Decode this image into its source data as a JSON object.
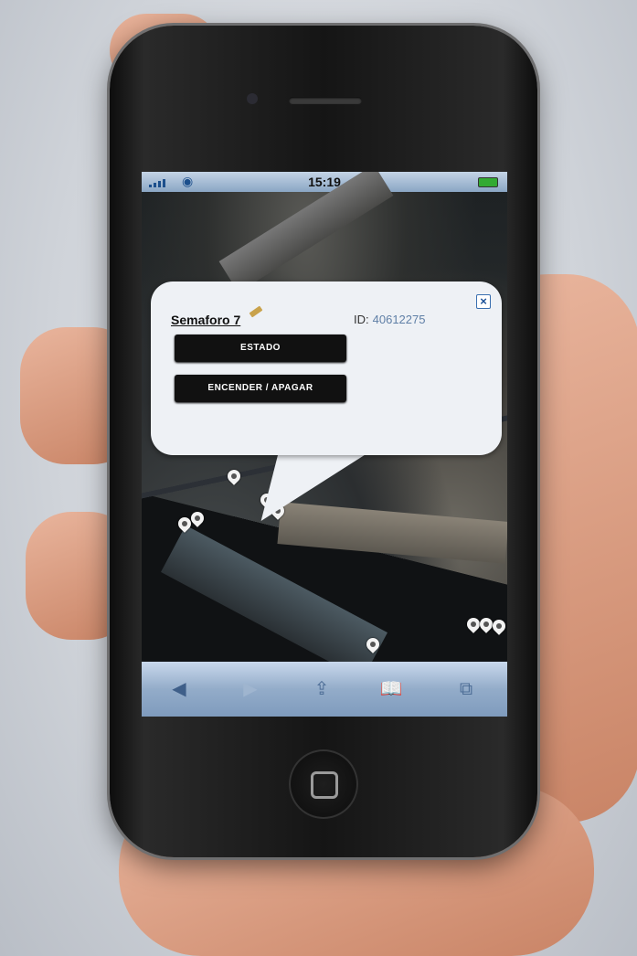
{
  "status_bar": {
    "time": "15:19"
  },
  "popup": {
    "title": "Semaforo 7",
    "id_label": "ID:",
    "id_value": "40612275",
    "buttons": [
      "ESTADO",
      "ENCENDER / APAGAR"
    ]
  },
  "toolbar": {
    "icons": [
      "back-icon",
      "forward-icon",
      "share-icon",
      "bookmarks-icon",
      "pages-icon"
    ],
    "glyphs": [
      "◀",
      "▶",
      "⇪",
      "📖",
      "⧉"
    ]
  },
  "colors": {
    "popup_bg": "#eef1f5",
    "button_bg": "#111111",
    "toolbar_top": "#c9d8ec"
  }
}
